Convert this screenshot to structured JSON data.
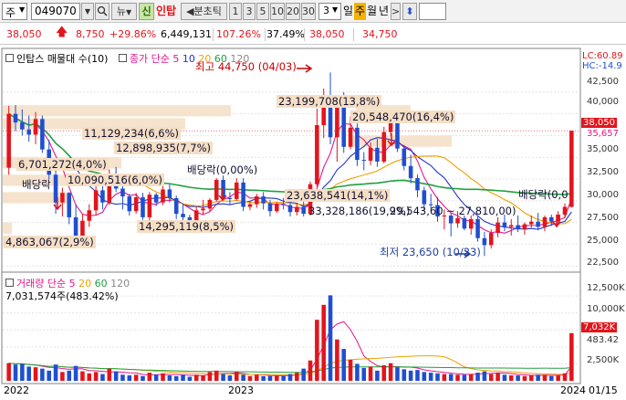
{
  "toolbar": {
    "market": "주",
    "code": "049070",
    "news_label": "뉴",
    "new_badge": "신",
    "stock_name": "인탑",
    "tick_label": "◀분초틱",
    "periods": [
      "1",
      "3",
      "5",
      "10",
      "20",
      "30"
    ],
    "count_value": "3",
    "view_types": [
      "일",
      "주",
      "월",
      "년"
    ],
    "active_view": "주"
  },
  "quote": {
    "price": "38,050",
    "change": "8,750",
    "change_pct": "+29.86%",
    "volume": "6,449,131",
    "volume_ratio": "107.26%",
    "turnover": "37.49%",
    "high": "38,050",
    "low": "34,750"
  },
  "right_labels": {
    "lc": "LC:60.89",
    "hc": "HC:-14.9",
    "current": "38,050",
    "ma_value": "35,657",
    "vol_current": "7,032K",
    "vol_ma": "483.42"
  },
  "price_legend": {
    "indicator": "인탑스 매물대 수(10)",
    "ma_title": "종가 단순 5",
    "ma_periods": [
      "10",
      "20",
      "60",
      "120"
    ]
  },
  "volume_legend": {
    "title": "거래량 단순 5",
    "ma_periods": [
      "20",
      "60",
      "120"
    ],
    "current": "7,031,574주(483.42%)"
  },
  "annotations": {
    "high": "최고 44,750 (04/03)",
    "low": "최저 23,650 (10/23)",
    "dividend_1": "배당락(0,00%)",
    "dividend_2": "배당락(0,0",
    "dividend_3": "배당락",
    "vp1": "11,129,234(6,6%)",
    "vp2": "12,898,935(7,7%)",
    "vp3": "6,701,272(4,0%)",
    "vp4": "10,090,516(6,0%)",
    "vp5": "14,295,119(8,5%)",
    "vp6": "4,863,067(2,9%)",
    "vp7": "23,199,708(13,8%)",
    "vp8": "20,548,470(16,4%)",
    "vp9": "23,638,541(14,1%)",
    "vp10": "33,328,186(19,9%)",
    "vp11": "29,543,60 ~ 27,810,00)"
  },
  "axes": {
    "price_ticks": [
      "42,500",
      "40,000",
      "37,500",
      "35,000",
      "32,500",
      "30,000",
      "27,500",
      "25,000",
      "22,500"
    ],
    "volume_ticks": [
      "12,500K",
      "10,000K",
      "2,500K"
    ],
    "x_labels": [
      "2022",
      "2023",
      "2024",
      "01/15"
    ]
  },
  "colors": {
    "up": "#e3141c",
    "down": "#1f4fd0",
    "ma5": "#e0178c",
    "ma10": "#2233cc",
    "ma20": "#f0a000",
    "ma60": "#20a040",
    "ma120": "#a0a0a0",
    "highlight": "#f5dec4"
  },
  "chart_data": {
    "type": "candlestick",
    "y_range": [
      22000,
      45000
    ],
    "volume_range": [
      0,
      14000
    ],
    "candles": [
      [
        33800,
        40900,
        33000,
        40000,
        2600
      ],
      [
        40000,
        41000,
        38000,
        39000,
        2400
      ],
      [
        39000,
        40500,
        37500,
        38200,
        2500
      ],
      [
        38200,
        39800,
        36800,
        37600,
        2100
      ],
      [
        37600,
        40200,
        36500,
        39400,
        2000
      ],
      [
        39400,
        39800,
        35500,
        35900,
        1800
      ],
      [
        35900,
        37000,
        32500,
        33000,
        1500
      ],
      [
        33000,
        34000,
        28500,
        29800,
        2400
      ],
      [
        29800,
        31500,
        28200,
        30900,
        1300
      ],
      [
        30900,
        31000,
        27300,
        28100,
        1500
      ],
      [
        28100,
        29600,
        24800,
        25800,
        2200
      ],
      [
        25800,
        28500,
        25000,
        27700,
        1400
      ],
      [
        27700,
        29600,
        27000,
        28900,
        1100
      ],
      [
        28900,
        31800,
        28300,
        31200,
        1300
      ],
      [
        31200,
        32400,
        29000,
        29800,
        1000
      ],
      [
        29800,
        33600,
        29500,
        32500,
        1800
      ],
      [
        32500,
        33900,
        31000,
        31400,
        1400
      ],
      [
        31400,
        31900,
        29000,
        30500,
        900
      ],
      [
        30500,
        30800,
        28300,
        28800,
        800
      ],
      [
        28800,
        30900,
        28500,
        30400,
        900
      ],
      [
        30400,
        30900,
        27800,
        28100,
        700
      ],
      [
        28100,
        31000,
        27600,
        30700,
        1200
      ],
      [
        30700,
        30900,
        29400,
        29800,
        900
      ],
      [
        29800,
        31800,
        29500,
        31300,
        1100
      ],
      [
        31300,
        31900,
        29800,
        30300,
        800
      ],
      [
        30300,
        30600,
        27900,
        28500,
        700
      ],
      [
        28500,
        29700,
        27200,
        28100,
        900
      ],
      [
        28100,
        28400,
        27000,
        27500,
        600
      ],
      [
        27500,
        29300,
        27200,
        28900,
        900
      ],
      [
        28900,
        30100,
        28400,
        29100,
        800
      ],
      [
        29100,
        30300,
        28700,
        30100,
        1300
      ],
      [
        30100,
        32600,
        29900,
        32400,
        1500
      ],
      [
        32400,
        32900,
        30100,
        30300,
        1000
      ],
      [
        30300,
        31000,
        29600,
        30200,
        800
      ],
      [
        30200,
        32600,
        30000,
        32100,
        1300
      ],
      [
        32100,
        32600,
        28800,
        29300,
        900
      ],
      [
        29300,
        29900,
        28900,
        29600,
        700
      ],
      [
        29600,
        30800,
        29200,
        30500,
        900
      ],
      [
        30500,
        31000,
        29000,
        29700,
        700
      ],
      [
        29700,
        30100,
        28200,
        28800,
        700
      ],
      [
        28800,
        29800,
        28600,
        29600,
        800
      ],
      [
        29600,
        30300,
        29000,
        29500,
        700
      ],
      [
        29500,
        29800,
        28200,
        28700,
        1000
      ],
      [
        28700,
        29700,
        28300,
        29300,
        1200
      ],
      [
        29300,
        31100,
        28200,
        28500,
        1800
      ],
      [
        28500,
        32200,
        28300,
        31900,
        3000
      ],
      [
        31900,
        40600,
        31600,
        38700,
        9000
      ],
      [
        38700,
        42900,
        37200,
        40900,
        11200
      ],
      [
        40900,
        44750,
        36500,
        37300,
        12600
      ],
      [
        37300,
        42000,
        34500,
        41200,
        6100
      ],
      [
        41200,
        42500,
        35500,
        36200,
        4700
      ],
      [
        36200,
        39700,
        35900,
        38400,
        3100
      ],
      [
        38400,
        38900,
        34000,
        34700,
        2500
      ],
      [
        34700,
        35600,
        33500,
        34600,
        1900
      ],
      [
        34600,
        36700,
        34100,
        36100,
        2100
      ],
      [
        36100,
        37100,
        33900,
        34500,
        1500
      ],
      [
        34500,
        38500,
        34300,
        37900,
        2300
      ],
      [
        37900,
        39900,
        37500,
        39100,
        2600
      ],
      [
        39100,
        39500,
        35600,
        36000,
        2000
      ],
      [
        36000,
        36400,
        33500,
        34000,
        1700
      ],
      [
        34000,
        35300,
        32000,
        32600,
        1500
      ],
      [
        32600,
        33000,
        30400,
        31200,
        1600
      ],
      [
        31200,
        31600,
        28900,
        29600,
        1300
      ],
      [
        29600,
        30800,
        29100,
        29500,
        1200
      ],
      [
        29500,
        30400,
        27600,
        28200,
        1100
      ],
      [
        28200,
        29000,
        26700,
        28300,
        1000
      ],
      [
        28300,
        28600,
        25900,
        27400,
        1000
      ],
      [
        27400,
        28800,
        26900,
        28000,
        900
      ],
      [
        28000,
        28300,
        26600,
        26800,
        900
      ],
      [
        26800,
        28300,
        26100,
        27900,
        1000
      ],
      [
        27900,
        28200,
        25300,
        25700,
        1200
      ],
      [
        25700,
        26400,
        23650,
        24900,
        1400
      ],
      [
        24900,
        26700,
        24500,
        26300,
        1000
      ],
      [
        26300,
        28100,
        25800,
        27500,
        1200
      ],
      [
        27500,
        28400,
        26500,
        27000,
        900
      ],
      [
        27000,
        27900,
        26000,
        27200,
        800
      ],
      [
        27200,
        28300,
        26400,
        26700,
        800
      ],
      [
        26700,
        27500,
        26100,
        27300,
        700
      ],
      [
        27300,
        28300,
        26900,
        27600,
        800
      ],
      [
        27600,
        28600,
        26600,
        27000,
        900
      ],
      [
        27000,
        28300,
        26500,
        28100,
        900
      ],
      [
        28100,
        28400,
        27100,
        27600,
        700
      ],
      [
        27600,
        28800,
        27200,
        28400,
        800
      ],
      [
        28400,
        29700,
        28000,
        29300,
        1100
      ],
      [
        29300,
        38050,
        29200,
        38050,
        7032
      ]
    ]
  }
}
